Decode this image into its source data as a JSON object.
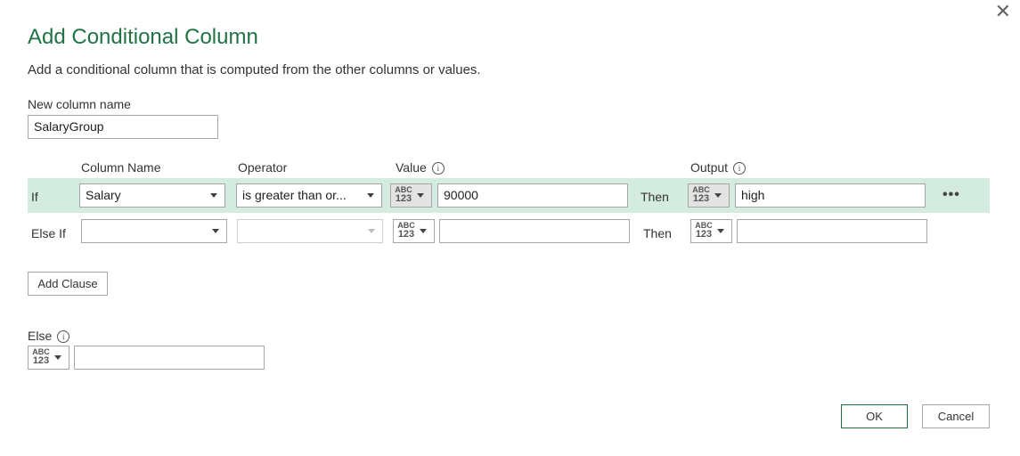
{
  "dialog": {
    "title": "Add Conditional Column",
    "subtitle": "Add a conditional column that is computed from the other columns or values.",
    "close_icon": "close-icon"
  },
  "new_column": {
    "label": "New column name",
    "value": "SalaryGroup"
  },
  "headers": {
    "column_name": "Column Name",
    "operator": "Operator",
    "value": "Value",
    "output": "Output",
    "info_glyph": "i"
  },
  "type_glyph": {
    "top": "ABC",
    "bottom": "123"
  },
  "clauses": [
    {
      "label": "If",
      "column": "Salary",
      "operator": "is greater than or...",
      "value": "90000",
      "then": "Then",
      "output": "high",
      "more": "•••"
    },
    {
      "label": "Else If",
      "column": "",
      "operator": "",
      "value": "",
      "then": "Then",
      "output": ""
    }
  ],
  "add_clause": "Add Clause",
  "else": {
    "label": "Else",
    "value": ""
  },
  "buttons": {
    "ok": "OK",
    "cancel": "Cancel"
  },
  "colors": {
    "accent": "#217346",
    "row_highlight": "#d3ecdf"
  }
}
